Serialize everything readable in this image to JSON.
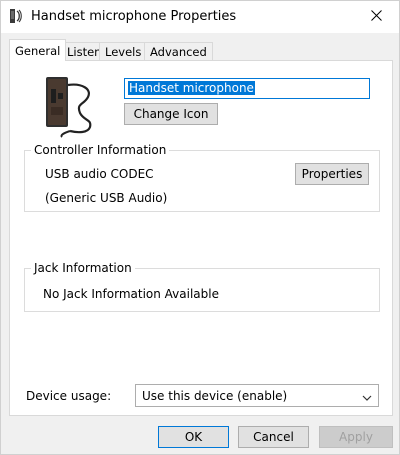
{
  "window": {
    "title": "Handset microphone Properties"
  },
  "tabs": [
    {
      "label": "General",
      "active": true
    },
    {
      "label": "Listen",
      "active": false
    },
    {
      "label": "Levels",
      "active": false
    },
    {
      "label": "Advanced",
      "active": false
    }
  ],
  "general": {
    "device_name": "Handset microphone",
    "change_icon_label": "Change Icon",
    "controller": {
      "group_label": "Controller Information",
      "name": "USB audio CODEC",
      "driver": "(Generic USB Audio)",
      "properties_label": "Properties"
    },
    "jack": {
      "group_label": "Jack Information",
      "text": "No Jack Information Available"
    },
    "device_usage": {
      "label": "Device usage:",
      "selected": "Use this device (enable)"
    }
  },
  "footer": {
    "ok_label": "OK",
    "cancel_label": "Cancel",
    "apply_label": "Apply",
    "apply_enabled": false
  },
  "colors": {
    "accent": "#0078d7",
    "panel": "#ffffff",
    "chrome": "#f0f0f0"
  },
  "icons": {
    "title": "microphone-icon",
    "close": "close-icon",
    "device": "handset-device-icon",
    "dropdown": "chevron-down-icon"
  }
}
